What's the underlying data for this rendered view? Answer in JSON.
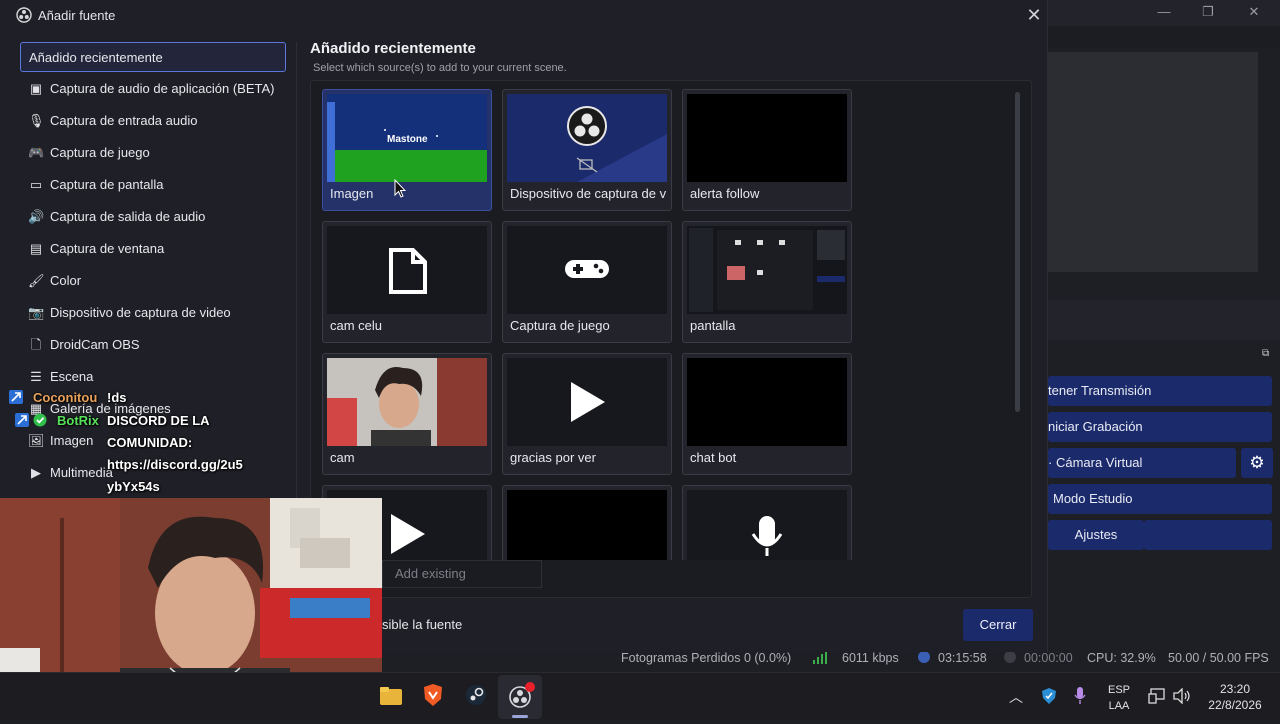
{
  "dialog": {
    "title": "Añadir fuente",
    "close_glyph": "✕",
    "heading": "Añadido recientemente",
    "subtitle": "Select which source(s) to add to your current scene.",
    "add_existing_placeholder": "Add existing",
    "visible_label": "sible la fuente",
    "close_button": "Cerrar"
  },
  "sidebar": {
    "items": [
      {
        "label": "Añadido recientemente",
        "icon": "none",
        "glyph": ""
      },
      {
        "label": "Captura de audio de aplicación (BETA)",
        "icon": "app-audio-icon",
        "glyph": "▣"
      },
      {
        "label": "Captura de entrada audio",
        "icon": "microphone-icon",
        "glyph": "🎙"
      },
      {
        "label": "Captura de juego",
        "icon": "gamepad-icon",
        "glyph": "🎮"
      },
      {
        "label": "Captura de pantalla",
        "icon": "monitor-icon",
        "glyph": "▭"
      },
      {
        "label": "Captura de salida de audio",
        "icon": "speaker-icon",
        "glyph": "🔊"
      },
      {
        "label": "Captura de ventana",
        "icon": "window-icon",
        "glyph": "▤"
      },
      {
        "label": "Color",
        "icon": "brush-icon",
        "glyph": "🖌"
      },
      {
        "label": "Dispositivo de captura de video",
        "icon": "camera-icon",
        "glyph": "📷"
      },
      {
        "label": "DroidCam OBS",
        "icon": "file-icon",
        "glyph": "🗋"
      },
      {
        "label": "Escena",
        "icon": "list-icon",
        "glyph": "☰"
      },
      {
        "label": "Galería de imágenes",
        "icon": "gallery-icon",
        "glyph": "▦"
      },
      {
        "label": "Imagen",
        "icon": "image-icon",
        "glyph": "🖼"
      },
      {
        "label": "Multimedia",
        "icon": "play-icon",
        "glyph": "▶"
      }
    ]
  },
  "sources": [
    {
      "label": "Imagen",
      "thumb": "mastone",
      "thumb_text": "Mastone"
    },
    {
      "label": "Dispositivo de captura de v",
      "thumb": "obs",
      "thumb_text": ""
    },
    {
      "label": "alerta follow",
      "thumb": "black",
      "thumb_text": ""
    },
    {
      "label": "cam celu",
      "thumb": "file",
      "thumb_text": ""
    },
    {
      "label": "Captura de juego",
      "thumb": "gamepad",
      "thumb_text": ""
    },
    {
      "label": "pantalla",
      "thumb": "screen",
      "thumb_text": ""
    },
    {
      "label": "cam",
      "thumb": "person",
      "thumb_text": ""
    },
    {
      "label": "gracias por ver",
      "thumb": "play",
      "thumb_text": ""
    },
    {
      "label": "chat bot",
      "thumb": "black",
      "thumb_text": ""
    },
    {
      "label": "",
      "thumb": "play",
      "thumb_text": ""
    },
    {
      "label": "",
      "thumb": "black",
      "thumb_text": ""
    },
    {
      "label": "",
      "thumb": "mic",
      "thumb_text": ""
    }
  ],
  "obs_controls": {
    "stop_stream": "tener Transmisión",
    "start_record": "niciar Grabación",
    "virtual_cam": "Cámara Virtual",
    "studio_mode": "Modo Estudio",
    "settings": "Ajustes"
  },
  "status_bar": {
    "dropped_frames": "Fotogramas Perdidos 0 (0.0%)",
    "bitrate": "6011 kbps",
    "stream_time": "03:15:58",
    "record_time": "00:00:00",
    "cpu": "CPU: 32.9%",
    "fps": "50.00 / 50.00 FPS"
  },
  "chat": [
    {
      "user": "Coconitou",
      "message": "!ds",
      "user_color": "#e8a15a"
    },
    {
      "user": "BotRix",
      "message": "DISCORD DE LA COMUNIDAD: https://discord.gg/2u5ybYx54s",
      "user_color": "#57e05a"
    }
  ],
  "chat_lines": {
    "line1": "DISCORD DE LA",
    "line2": "COMUNIDAD:",
    "line3": "https://discord.gg/2u5",
    "line4": "ybYx54s"
  },
  "taskbar": {
    "lang_top": "ESP",
    "lang_bottom": "LAA",
    "time": "23:20",
    "date": "22/8/2026",
    "chevron": "︿"
  },
  "colors": {
    "accent_button": "#1b2a6b",
    "selected_card": "#25326a",
    "selected_border": "#5a79e0"
  }
}
